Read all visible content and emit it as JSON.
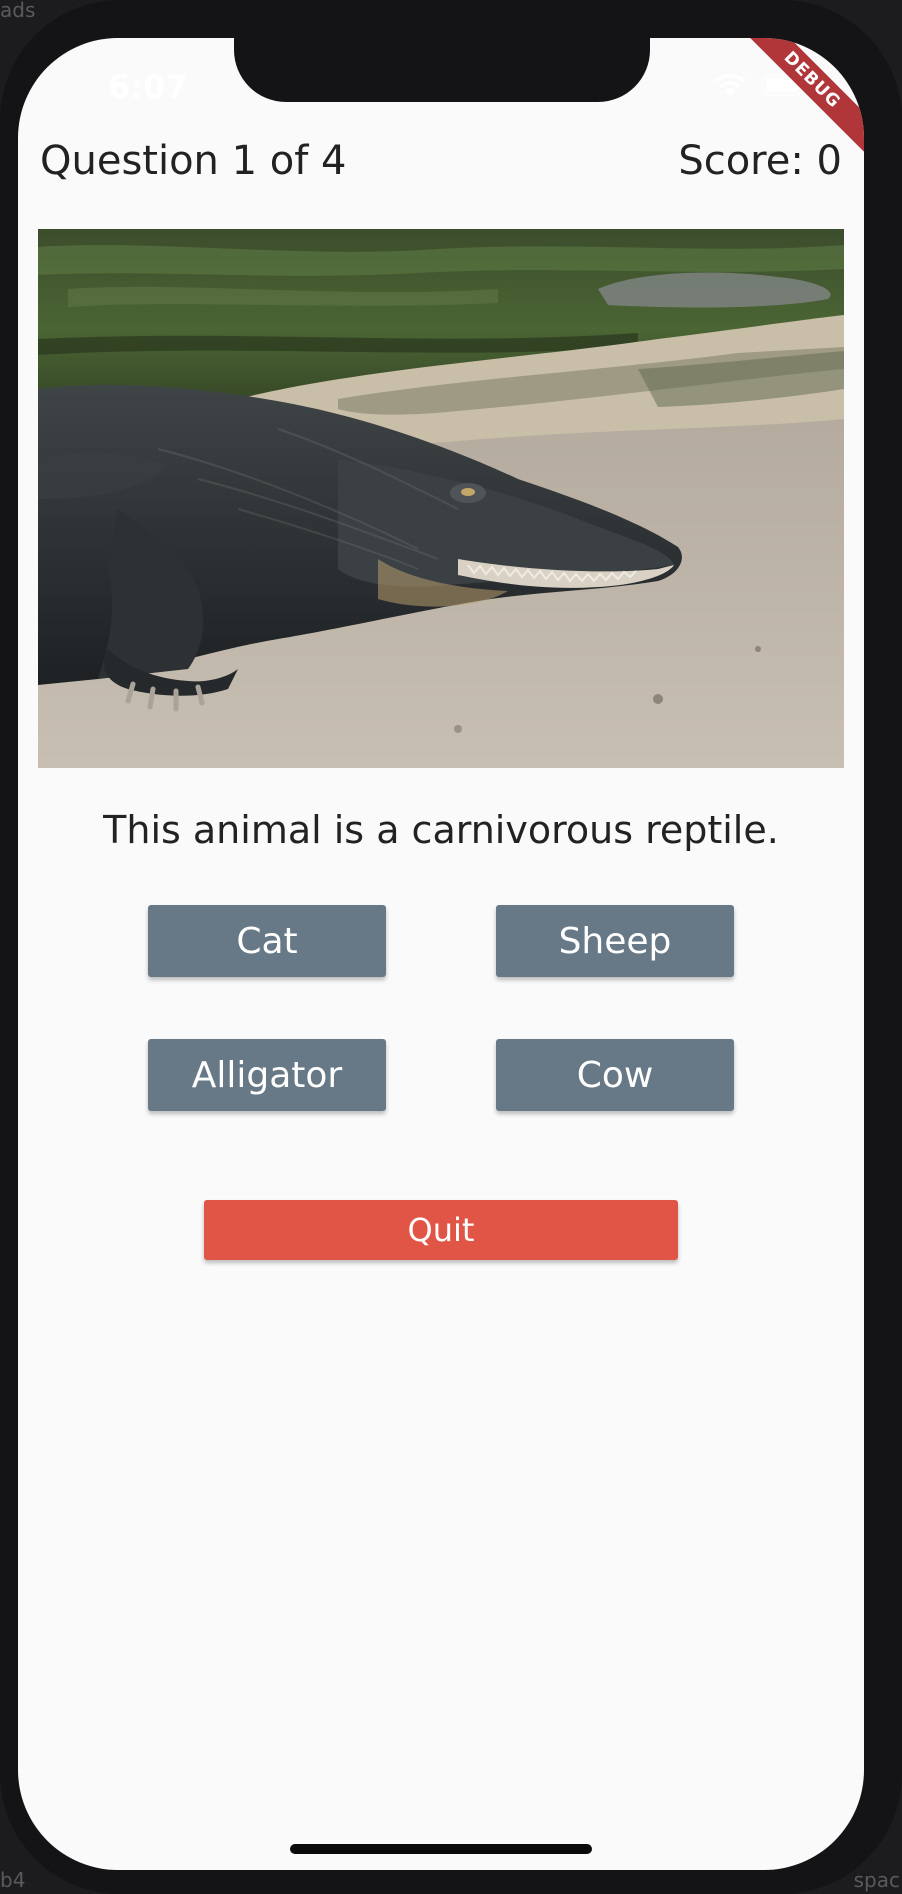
{
  "background": {
    "top_left_fragment": "ads",
    "bottom_left_fragment": "b4",
    "bottom_right_fragment": "spac"
  },
  "status_bar": {
    "time": "6:07",
    "icons": [
      "wifi-icon",
      "battery-icon"
    ]
  },
  "debug_banner": {
    "label": "DEBUG",
    "color": "#b0363a"
  },
  "header": {
    "question_counter": "Question 1 of 4",
    "score": "Score: 0"
  },
  "question": {
    "image": "alligator-photo",
    "hint": "This animal is a carnivorous reptile."
  },
  "answers": [
    {
      "label": "Cat"
    },
    {
      "label": "Sheep"
    },
    {
      "label": "Alligator"
    },
    {
      "label": "Cow"
    }
  ],
  "quit_button": {
    "label": "Quit",
    "color": "#e05545"
  },
  "colors": {
    "answer_button": "#677986",
    "screen_background": "#fafafa",
    "text": "#222222"
  }
}
